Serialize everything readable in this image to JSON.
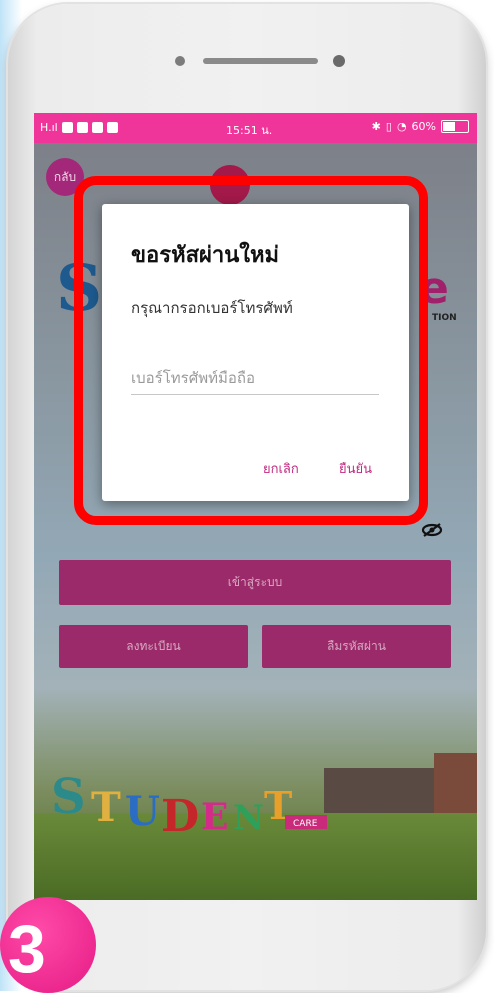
{
  "status_bar": {
    "signal": "H.ıl",
    "time": "15:51 น.",
    "battery": "60%"
  },
  "login_screen": {
    "back_label": "กลับ",
    "logo_letter_left": "S",
    "logo_letter_right": "e",
    "logo_subtext": "TION",
    "login_button": "เข้าสู่ระบบ",
    "register_button": "ลงทะเบียน",
    "forgot_button": "ลืมรหัสผ่าน",
    "student_logo": "STUDENT CARE"
  },
  "dialog": {
    "title": "ขอรหัสผ่านใหม่",
    "message": "กรุณากรอกเบอร์โทรศัพท์",
    "phone_placeholder": "เบอร์โทรศัพท์มือถือ",
    "cancel": "ยกเลิก",
    "confirm": "ยืนยัน"
  },
  "step": {
    "number": "3"
  },
  "colors": {
    "status_bar": "#f0359a",
    "accent": "#9a2a69",
    "dialog_button": "#c22a80",
    "highlight": "#ff0000",
    "badge": "#e51b84"
  },
  "icons": [
    "camera-icon",
    "speaker-icon",
    "eye-off-icon",
    "battery-icon",
    "wifi-icon"
  ]
}
